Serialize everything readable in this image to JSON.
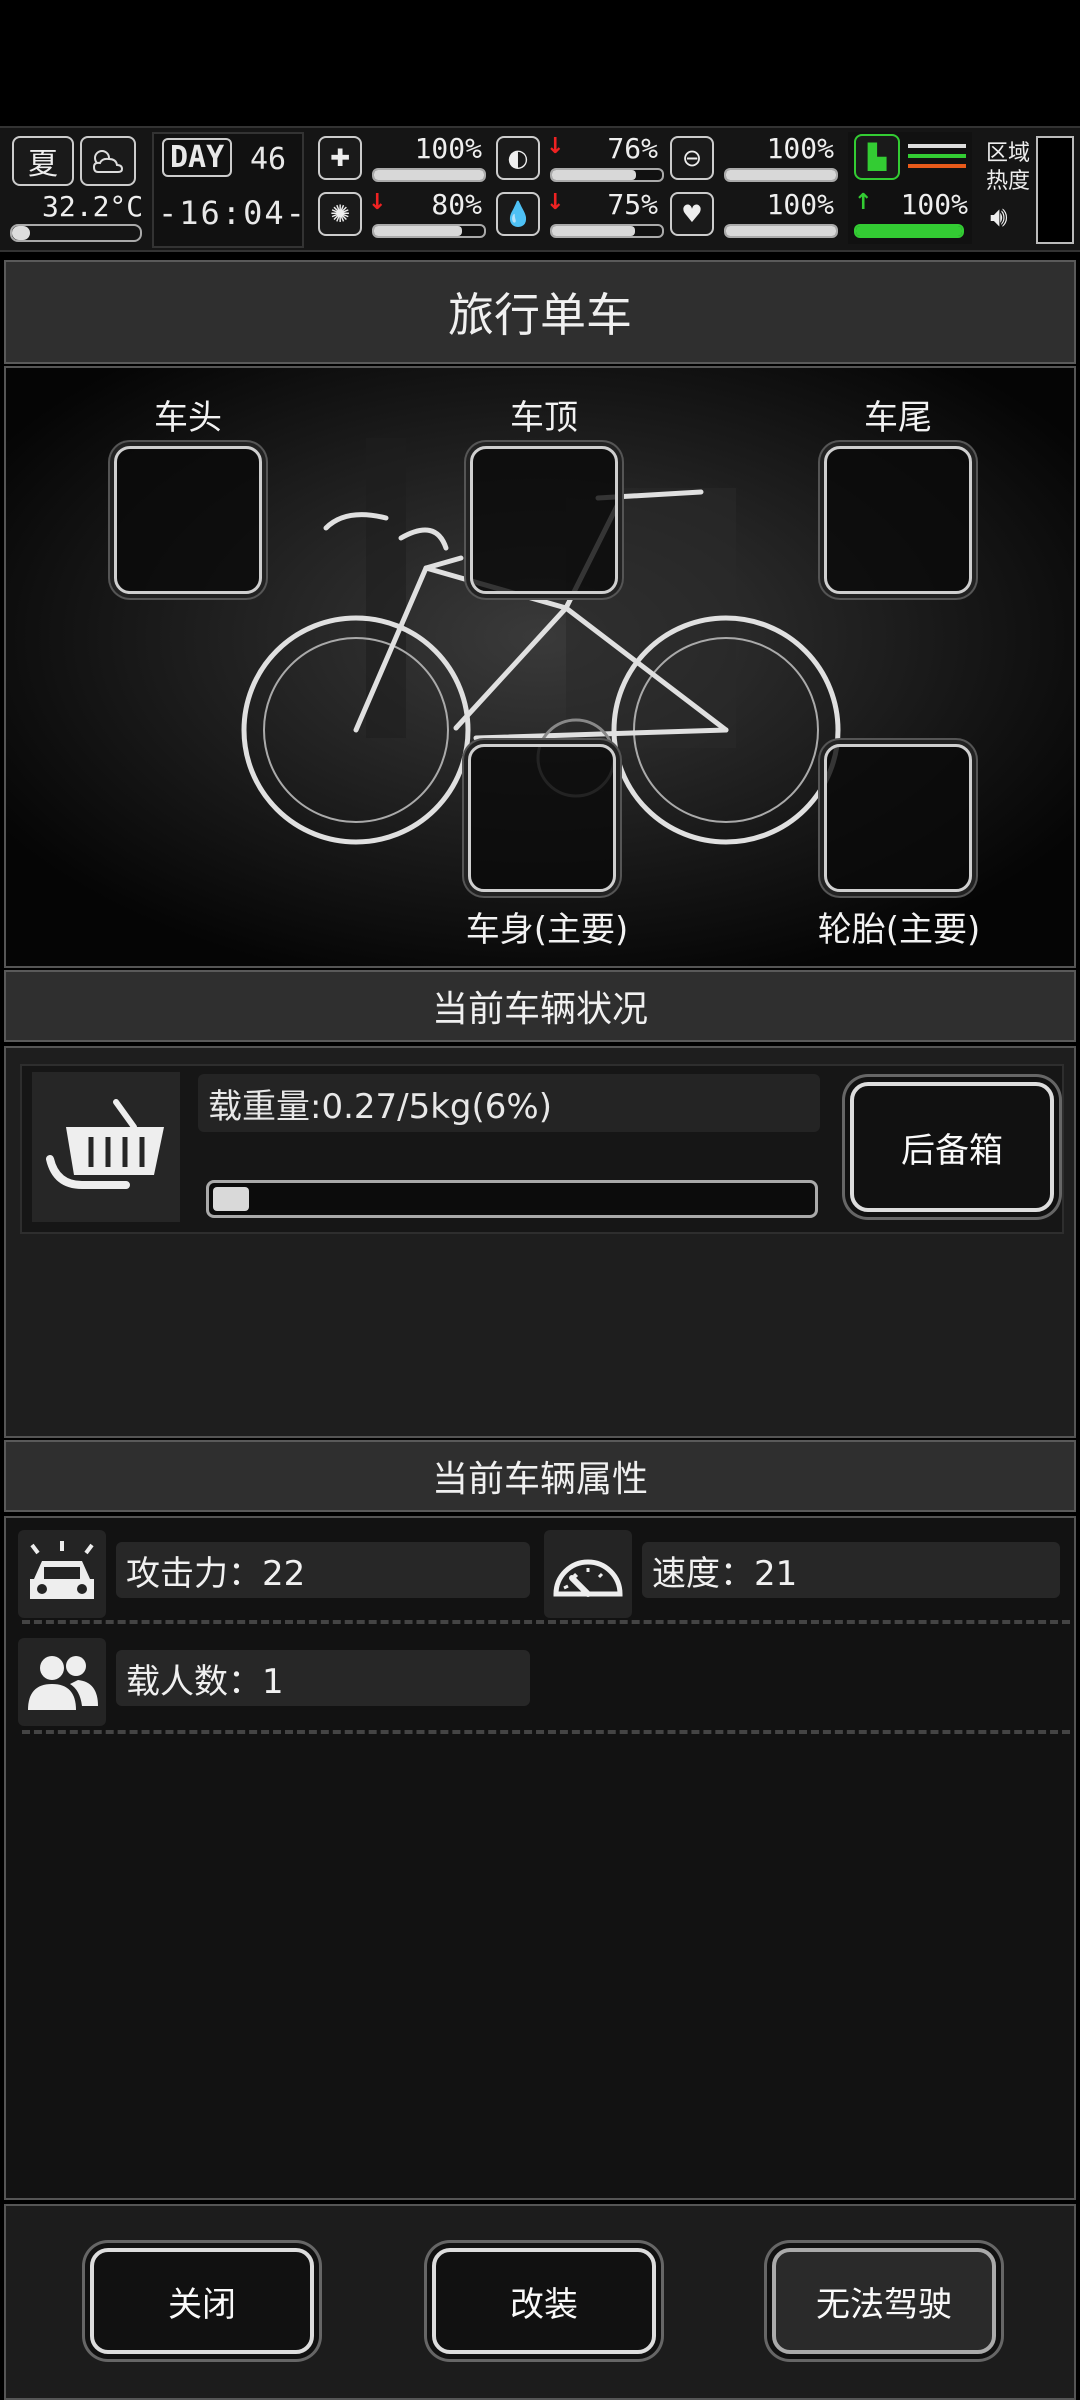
{
  "hud": {
    "season": "夏",
    "temperature": "32.2°C",
    "day_label": "DAY",
    "day_number": "46",
    "clock": "-16:04-",
    "stats": [
      {
        "name": "health",
        "icon": "medkit-icon",
        "value": "100%",
        "fill": 1.0,
        "arrow": ""
      },
      {
        "name": "hunger",
        "icon": "stomach-icon",
        "value": "76%",
        "fill": 0.76,
        "arrow": "down"
      },
      {
        "name": "pills",
        "icon": "pill-icon",
        "value": "100%",
        "fill": 1.0,
        "arrow": ""
      },
      {
        "name": "sanity",
        "icon": "brain-icon",
        "value": "80%",
        "fill": 0.8,
        "arrow": "down"
      },
      {
        "name": "thirst",
        "icon": "water-drop-icon",
        "value": "75%",
        "fill": 0.75,
        "arrow": "down"
      },
      {
        "name": "heart",
        "icon": "heart-icon",
        "value": "100%",
        "fill": 1.0,
        "arrow": ""
      }
    ],
    "stamina": {
      "value": "100%",
      "fill": 1.0,
      "arrow": "up"
    },
    "region_heat_label_1": "区域",
    "region_heat_label_2": "热度"
  },
  "title": "旅行单车",
  "slots": {
    "head": "车头",
    "top": "车顶",
    "tail": "车尾",
    "body": "车身(主要)",
    "tire": "轮胎(主要)"
  },
  "status": {
    "header": "当前车辆状况",
    "load_text": "载重量:0.27/5kg(6%)",
    "load_fill": 0.06,
    "trunk_button": "后备箱"
  },
  "attributes": {
    "header": "当前车辆属性",
    "attack": "攻击力：22",
    "speed": "速度：21",
    "passengers": "载人数：1"
  },
  "buttons": {
    "close": "关闭",
    "modify": "改装",
    "drive": "无法驾驶"
  }
}
